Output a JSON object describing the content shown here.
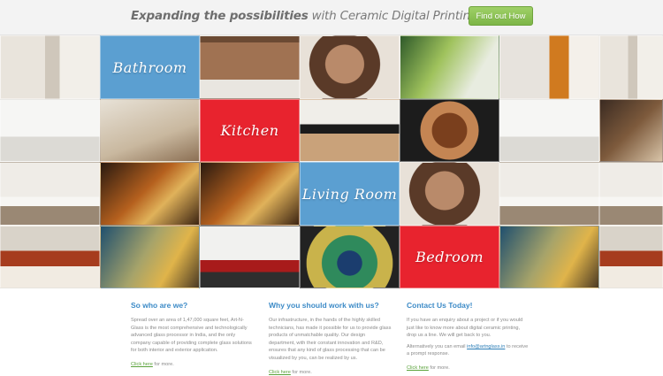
{
  "header": {
    "tagline_bold": "Expanding the possibilities",
    "tagline_rest": " with Ceramic Digital Printing",
    "cta_label": "Find out How"
  },
  "mosaic": {
    "labels": {
      "bathroom": "Bathroom",
      "kitchen": "Kitchen",
      "living_room": "Living Room",
      "bedroom": "Bedroom"
    },
    "colors": {
      "blue": "#5b9fd1",
      "red": "#e8232e"
    }
  },
  "columns": [
    {
      "title": "So who are we?",
      "paragraphs": [
        "Spread over an area of 1,47,000 square feet, Art-N-Glass is the most comprehensive and technologically advanced glass processor in India, and the only company capable of providing complete glass solutions for both interior and exterior application."
      ],
      "link": "Click here",
      "link_suffix": " for more."
    },
    {
      "title": "Why you should work with us?",
      "paragraphs": [
        "Our infrastructure, in the hands of the highly skilled technicians, has made it possible for us to provide glass products of unmatchable quality. Our design department, with their constant innovation and R&D, ensures that any kind of glass processing that can be visualized by you, can be realized by us."
      ],
      "link": "Click here",
      "link_suffix": " for more."
    },
    {
      "title": "Contact Us Today!",
      "paragraphs": [
        "If you have an enquiry about a project or if you would just like to know more about digital ceramic printing, drop us a line. We will get back to you."
      ],
      "alt_prefix": "Alternatively you can email ",
      "email": "info@artnglass.in",
      "alt_suffix": " to receive a prompt response.",
      "link": "Click here",
      "link_suffix": " for more."
    }
  ]
}
